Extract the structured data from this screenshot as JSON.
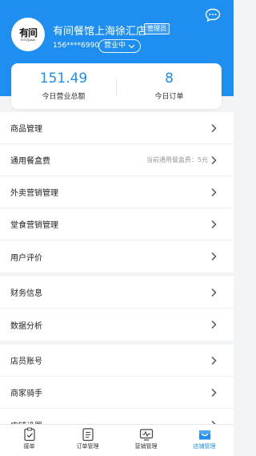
{
  "header": {
    "store_name": "有间餐馆上海徐汇店",
    "role_badge": "管理员",
    "phone": "156****6990",
    "status": "营业中"
  },
  "stats": {
    "revenue_value": "151.49",
    "revenue_label": "今日营业总额",
    "orders_value": "8",
    "orders_label": "今日订单"
  },
  "menu": {
    "group1": [
      {
        "label": "商品管理"
      },
      {
        "label": "通用餐盒费",
        "hint": "当前通用餐盒费：5元"
      },
      {
        "label": "外卖营销管理"
      },
      {
        "label": "堂食营销管理"
      },
      {
        "label": "用户评价"
      }
    ],
    "group2": [
      {
        "label": "财务信息"
      },
      {
        "label": "数据分析"
      }
    ],
    "group3": [
      {
        "label": "店员账号"
      },
      {
        "label": "商家骑手"
      },
      {
        "label": "店铺设置"
      }
    ]
  },
  "tabbar": [
    {
      "label": "接单",
      "icon": "clipboard-check-icon"
    },
    {
      "label": "订单管理",
      "icon": "order-list-icon"
    },
    {
      "label": "营销管理",
      "icon": "marketing-monitor-icon"
    },
    {
      "label": "店铺管理",
      "icon": "store-icon",
      "active": true
    }
  ],
  "colors": {
    "accent": "#1e8ef0",
    "background": "#f3f4f6"
  }
}
